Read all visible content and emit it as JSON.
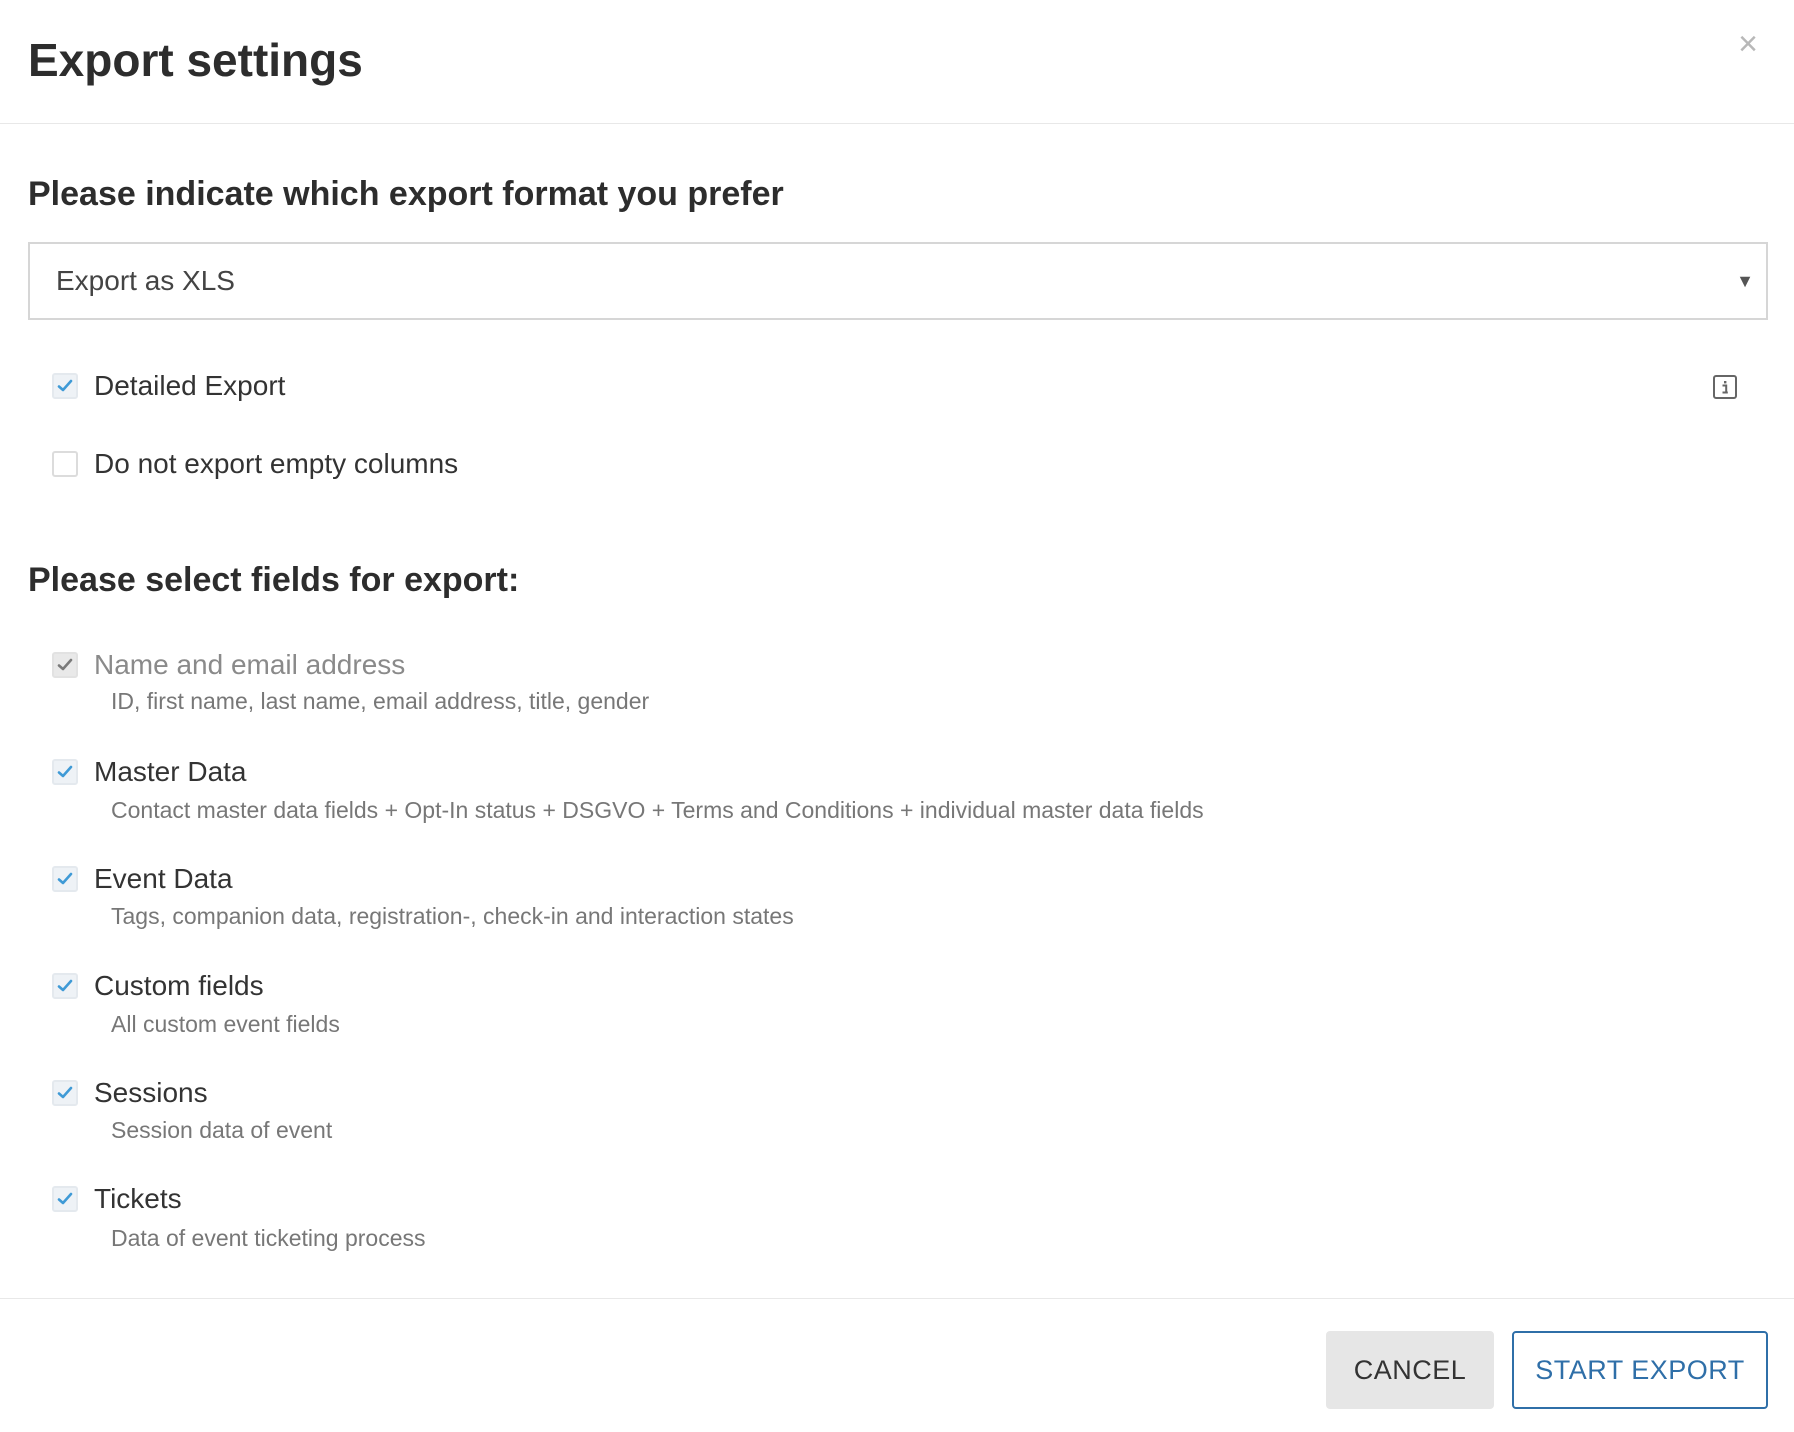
{
  "dialog": {
    "title": "Export settings",
    "close_symbol": "×"
  },
  "format_section": {
    "title": "Please indicate which export format you prefer",
    "select": {
      "value": "Export as XLS",
      "arrow_symbol": "▼"
    }
  },
  "options": [
    {
      "label": "Detailed Export",
      "checked": true
    },
    {
      "label": "Do not export empty columns",
      "checked": false
    }
  ],
  "fields_section": {
    "title": "Please select fields for export:",
    "fields": [
      {
        "label": "Name and email address",
        "description": "ID, first name, last name, email address, title, gender",
        "checked": true,
        "disabled": true
      },
      {
        "label": "Master Data",
        "description": "Contact master data fields + Opt-In status + DSGVO + Terms and Conditions + individual master data fields",
        "checked": true,
        "disabled": false
      },
      {
        "label": "Event Data",
        "description": "Tags, companion data, registration-, check-in and interaction states",
        "checked": true,
        "disabled": false
      },
      {
        "label": "Custom fields",
        "description": "All custom event fields",
        "checked": true,
        "disabled": false
      },
      {
        "label": "Sessions",
        "description": "Session data of event",
        "checked": true,
        "disabled": false
      },
      {
        "label": "Tickets",
        "description": "Data of event ticketing process",
        "checked": true,
        "disabled": false
      }
    ]
  },
  "footer": {
    "cancel_label": "CANCEL",
    "start_label": "START EXPORT"
  },
  "icons": {
    "checkmark": "check-icon",
    "info": "info-icon",
    "close": "close-icon"
  },
  "colors": {
    "check_active": "#3f9ad6",
    "check_disabled": "#7a7a7a",
    "primary": "#2f6fa8"
  }
}
